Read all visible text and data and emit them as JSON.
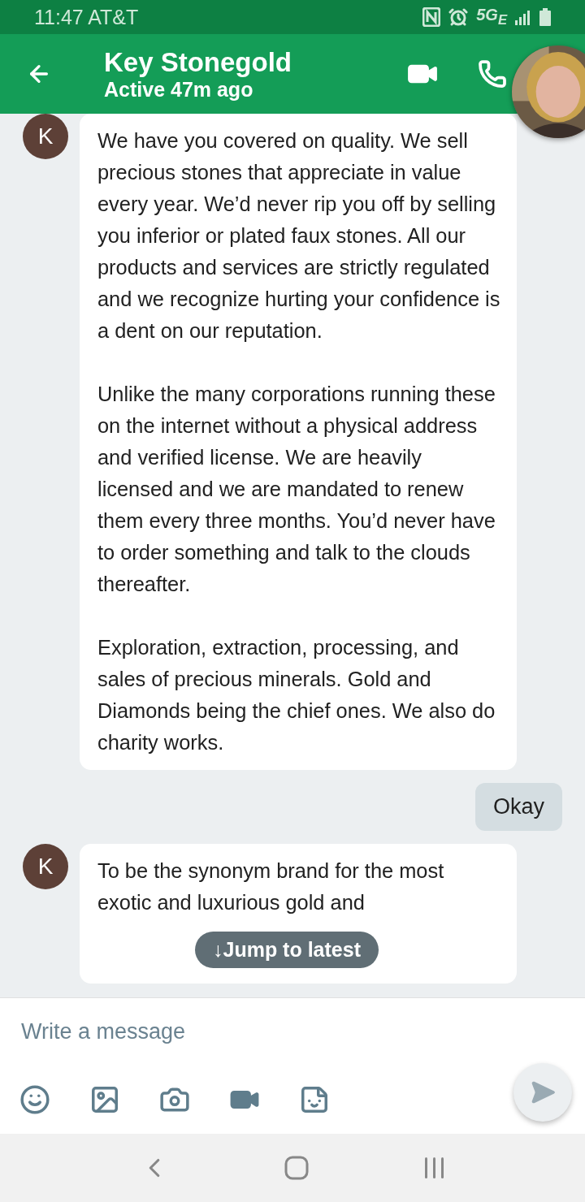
{
  "status_bar": {
    "time": "11:47 AT&T",
    "network": "5G$_{E}$"
  },
  "header": {
    "title": "Key Stonegold",
    "subtitle": "Active 47m ago"
  },
  "messages": [
    {
      "kind": "incoming",
      "avatar": "K",
      "paragraphs": [
        "We have you covered on quality. We sell precious stones that appreciate in value every year. We’d never rip you off by selling you inferior or plated faux stones. All our products and services are strictly regulated and we recognize hurting your confidence is a dent on our reputation.",
        "Unlike the many corporations running these on the internet without a physical address and verified license. We are heavily licensed and we are mandated to renew them every three months. You’d never have to order something and talk to the clouds thereafter.",
        "Exploration, extraction, processing, and sales of precious minerals. Gold and Diamonds being the chief ones. We also do charity works."
      ]
    },
    {
      "kind": "outgoing",
      "text": "Okay"
    },
    {
      "kind": "incoming",
      "avatar": "K",
      "paragraphs": [
        "To be the synonym brand for the most exotic and luxurious gold and"
      ]
    }
  ],
  "jump_button": {
    "arrow": "↓",
    "label": "Jump to latest"
  },
  "composer": {
    "placeholder": "Write a message"
  }
}
